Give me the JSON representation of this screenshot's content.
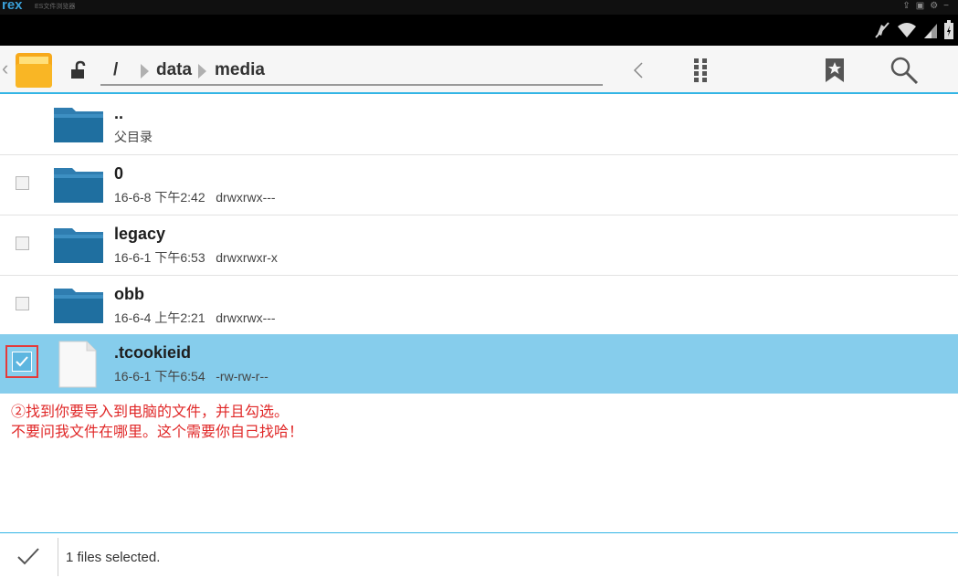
{
  "topstrip": {
    "brand": "rex",
    "brand_sub": "ES文件浏览器",
    "icons": [
      "share-icon",
      "window-icon",
      "gear-icon",
      "dash-icon"
    ]
  },
  "statusbar": {
    "icons": [
      "mute-icon",
      "wifi-icon",
      "signal-icon",
      "battery-icon"
    ]
  },
  "toolbar": {
    "path": [
      "/",
      "data",
      "media"
    ],
    "buttons": [
      "back-icon",
      "grid-icon",
      "bookmark-icon",
      "search-icon"
    ]
  },
  "files": [
    {
      "name": "..",
      "meta": "父目录",
      "type": "folder",
      "has_checkbox": false,
      "checked": false
    },
    {
      "name": "0",
      "meta": "16-6-8 下午2:42   drwxrwx---",
      "type": "folder",
      "has_checkbox": true,
      "checked": false
    },
    {
      "name": "legacy",
      "meta": "16-6-1 下午6:53   drwxrwxr-x",
      "type": "folder",
      "has_checkbox": true,
      "checked": false
    },
    {
      "name": "obb",
      "meta": "16-6-4 上午2:21   drwxrwx---",
      "type": "folder",
      "has_checkbox": true,
      "checked": false
    },
    {
      "name": ".tcookieid",
      "meta": "16-6-1 下午6:54   -rw-rw-r--",
      "type": "file",
      "has_checkbox": true,
      "checked": true
    }
  ],
  "annotation": {
    "line1": "②找到你要导入到电脑的文件，并且勾选。",
    "line2": "不要问我文件在哪里。这个需要你自己找哈！"
  },
  "bottom": {
    "status": "1 files selected."
  },
  "colors": {
    "accent": "#33b5e5",
    "selected_row": "#86cdec",
    "annotation": "#e02828",
    "folder": "#1f6fa0"
  }
}
